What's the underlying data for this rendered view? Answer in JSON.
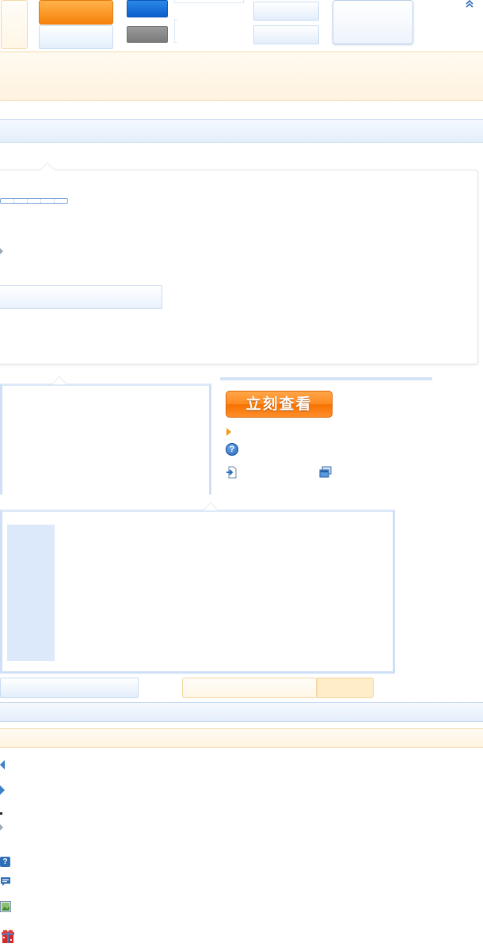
{
  "cta": {
    "label": "立刻查看"
  },
  "colors": {
    "accent_orange": "#f7820c",
    "accent_blue": "#0a5fcc",
    "panel_blue": "#dce9fb",
    "cream": "#fff6e6"
  },
  "icons": [
    "collapse-up-icon",
    "play-arrow-icon",
    "help-icon",
    "export-icon",
    "window-icon",
    "left-arrow-icon",
    "right-arrow-icon",
    "help-square-icon",
    "comment-icon",
    "picture-icon",
    "gift-icon"
  ]
}
